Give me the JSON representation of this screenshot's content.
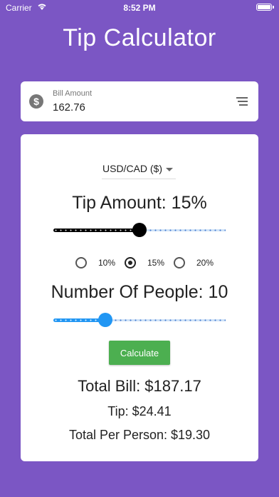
{
  "status_bar": {
    "carrier": "Carrier",
    "time": "8:52 PM"
  },
  "app": {
    "title": "Tip Calculator"
  },
  "bill": {
    "label": "Bill Amount",
    "value": "162.76"
  },
  "currency": {
    "selected": "USD/CAD ($)"
  },
  "tip": {
    "heading": "Tip Amount: 15%",
    "slider_fraction": 0.5,
    "options": [
      {
        "label": "10%",
        "selected": false
      },
      {
        "label": "15%",
        "selected": true
      },
      {
        "label": "20%",
        "selected": false
      }
    ]
  },
  "people": {
    "heading": "Number Of People: 10",
    "slider_fraction": 0.3
  },
  "actions": {
    "calculate_label": "Calculate"
  },
  "results": {
    "total_bill": "Total Bill: $187.17",
    "tip": "Tip: $24.41",
    "per_person": "Total Per Person: $19.30"
  },
  "colors": {
    "background": "#7b56c4",
    "tip_slider": "#000000",
    "people_slider": "#2196f3",
    "calculate_button": "#4caf50"
  }
}
